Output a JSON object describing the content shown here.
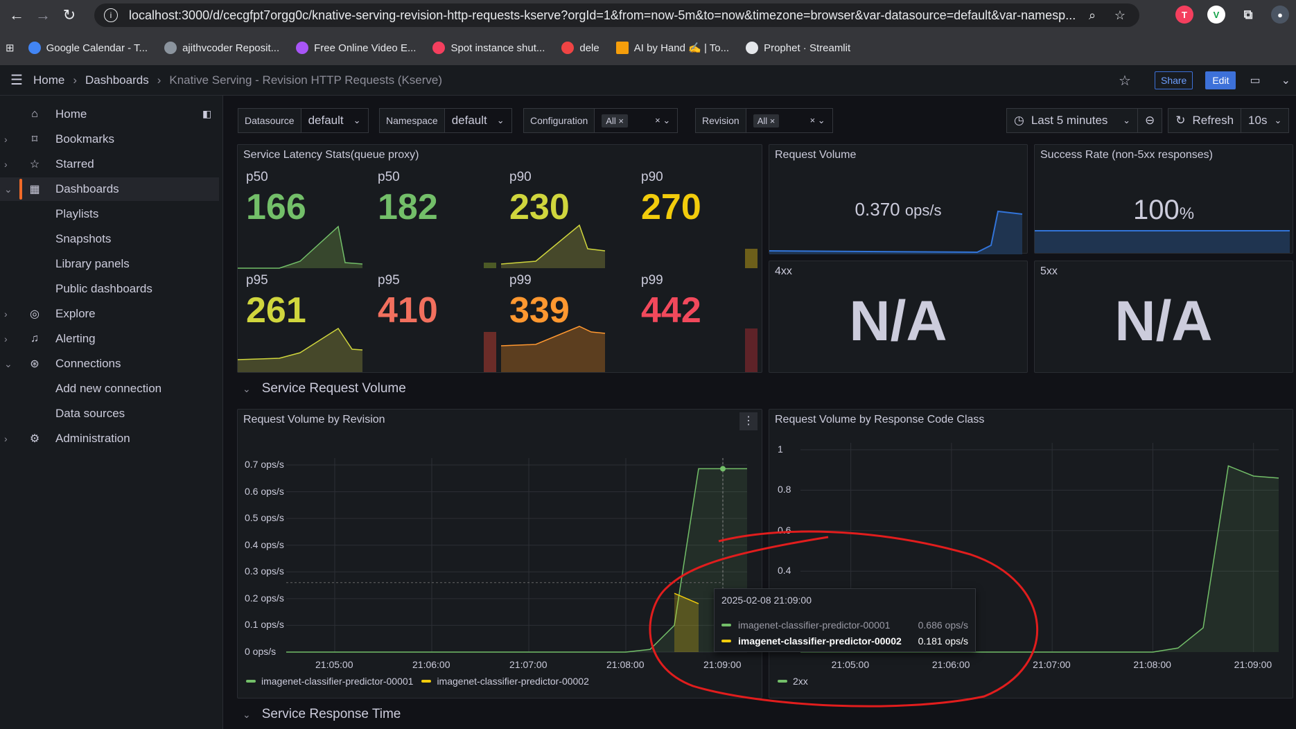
{
  "browser": {
    "url": "localhost:3000/d/cecgfpt7orgg0c/knative-serving-revision-http-requests-kserve?orgId=1&from=now-5m&to=now&timezone=browser&var-datasource=default&var-namesp...",
    "bookmarks": [
      {
        "label": "Google Calendar - T...",
        "color": "#4285f4"
      },
      {
        "label": "ajithvcoder Reposit...",
        "color": "#8b949e"
      },
      {
        "label": "Free Online Video E...",
        "color": "#a855f7"
      },
      {
        "label": "Spot instance shut...",
        "color": "#f43f5e"
      },
      {
        "label": "dele",
        "color": "#ef4444"
      },
      {
        "label": "AI by Hand ✍️ | To...",
        "color": "#f59e0b"
      },
      {
        "label": "Prophet · Streamlit",
        "color": "#e5e7eb"
      }
    ]
  },
  "topnav": {
    "crumbs": [
      "Home",
      "Dashboards",
      "Knative Serving - Revision HTTP Requests (Kserve)"
    ],
    "share": "Share",
    "edit": "Edit"
  },
  "sidebar": {
    "items": [
      {
        "label": "Home",
        "icon": "home-icon",
        "chev": ""
      },
      {
        "label": "Bookmarks",
        "icon": "bookmark-icon",
        "chev": "›"
      },
      {
        "label": "Starred",
        "icon": "star-icon",
        "chev": "›"
      },
      {
        "label": "Dashboards",
        "icon": "dashboards-icon",
        "chev": "⌄"
      },
      {
        "label": "Playlists"
      },
      {
        "label": "Snapshots"
      },
      {
        "label": "Library panels"
      },
      {
        "label": "Public dashboards"
      },
      {
        "label": "Explore",
        "icon": "explore-icon",
        "chev": "›"
      },
      {
        "label": "Alerting",
        "icon": "bell-icon",
        "chev": "›"
      },
      {
        "label": "Connections",
        "icon": "connections-icon",
        "chev": "⌄"
      },
      {
        "label": "Add new connection"
      },
      {
        "label": "Data sources"
      },
      {
        "label": "Administration",
        "icon": "gear-icon",
        "chev": "›"
      }
    ]
  },
  "variables": {
    "datasource": {
      "label": "Datasource",
      "value": "default"
    },
    "namespace": {
      "label": "Namespace",
      "value": "default"
    },
    "configuration": {
      "label": "Configuration",
      "value": "All"
    },
    "revision": {
      "label": "Revision",
      "value": "All"
    }
  },
  "timepicker": {
    "range": "Last 5 minutes",
    "refresh": "Refresh",
    "interval": "10s"
  },
  "panels": {
    "latency": {
      "title": "Service Latency Stats(queue proxy)",
      "stats": [
        {
          "label": "p50",
          "value": "166",
          "color": "#73bf69"
        },
        {
          "label": "p50",
          "value": "182",
          "color": "#73bf69"
        },
        {
          "label": "p90",
          "value": "230",
          "color": "#d0d63d"
        },
        {
          "label": "p90",
          "value": "270",
          "color": "#f2cc0c"
        },
        {
          "label": "p95",
          "value": "261",
          "color": "#d0d63d"
        },
        {
          "label": "p95",
          "value": "410",
          "color": "#f2705e"
        },
        {
          "label": "p99",
          "value": "339",
          "color": "#ff9830"
        },
        {
          "label": "p99",
          "value": "442",
          "color": "#f2495c"
        }
      ]
    },
    "request_volume": {
      "title": "Request Volume",
      "value": "0.370",
      "unit": "ops/s"
    },
    "success_rate": {
      "title": "Success Rate (non-5xx responses)",
      "value": "100",
      "unit": "%"
    },
    "err4xx": {
      "title": "4xx",
      "value": "N/A"
    },
    "err5xx": {
      "title": "5xx",
      "value": "N/A"
    }
  },
  "rows": {
    "request_volume": "Service Request Volume",
    "response_time": "Service Response Time"
  },
  "chart_data": [
    {
      "type": "line",
      "title": "Request Volume by Revision",
      "x": [
        "21:04:30",
        "21:05:00",
        "21:06:00",
        "21:07:00",
        "21:08:00",
        "21:08:15",
        "21:08:30",
        "21:08:45",
        "21:09:00",
        "21:09:15"
      ],
      "xticks": [
        "21:05:00",
        "21:06:00",
        "21:07:00",
        "21:08:00",
        "21:09:00"
      ],
      "yticks": [
        "0 ops/s",
        "0.1 ops/s",
        "0.2 ops/s",
        "0.3 ops/s",
        "0.4 ops/s",
        "0.5 ops/s",
        "0.6 ops/s",
        "0.7 ops/s"
      ],
      "ylim": [
        0,
        0.7
      ],
      "series": [
        {
          "name": "imagenet-classifier-predictor-00001",
          "color": "#73bf69",
          "values": [
            0,
            0,
            0,
            0,
            0,
            0.01,
            0.1,
            0.686,
            0.686,
            0.686
          ]
        },
        {
          "name": "imagenet-classifier-predictor-00002",
          "color": "#f2cc0c",
          "values": [
            null,
            null,
            null,
            null,
            null,
            null,
            0.22,
            0.181,
            null,
            null
          ]
        }
      ],
      "tooltip": {
        "time": "2025-02-08 21:09:00",
        "rows": [
          {
            "name": "imagenet-classifier-predictor-00001",
            "value": "0.686 ops/s"
          },
          {
            "name": "imagenet-classifier-predictor-00002",
            "value": "0.181 ops/s"
          }
        ]
      }
    },
    {
      "type": "line",
      "title": "Request Volume by Response Code Class",
      "x": [
        "21:04:30",
        "21:05:00",
        "21:06:00",
        "21:07:00",
        "21:08:00",
        "21:08:15",
        "21:08:30",
        "21:08:45",
        "21:09:00",
        "21:09:15"
      ],
      "xticks": [
        "21:05:00",
        "21:06:00",
        "21:07:00",
        "21:08:00",
        "21:09:00"
      ],
      "yticks": [
        "0.4",
        "0.6",
        "0.8",
        "1"
      ],
      "ylim": [
        0,
        1
      ],
      "series": [
        {
          "name": "2xx",
          "color": "#73bf69",
          "values": [
            0,
            0,
            0,
            0,
            0,
            0.02,
            0.12,
            0.92,
            0.87,
            0.86
          ]
        }
      ]
    }
  ]
}
